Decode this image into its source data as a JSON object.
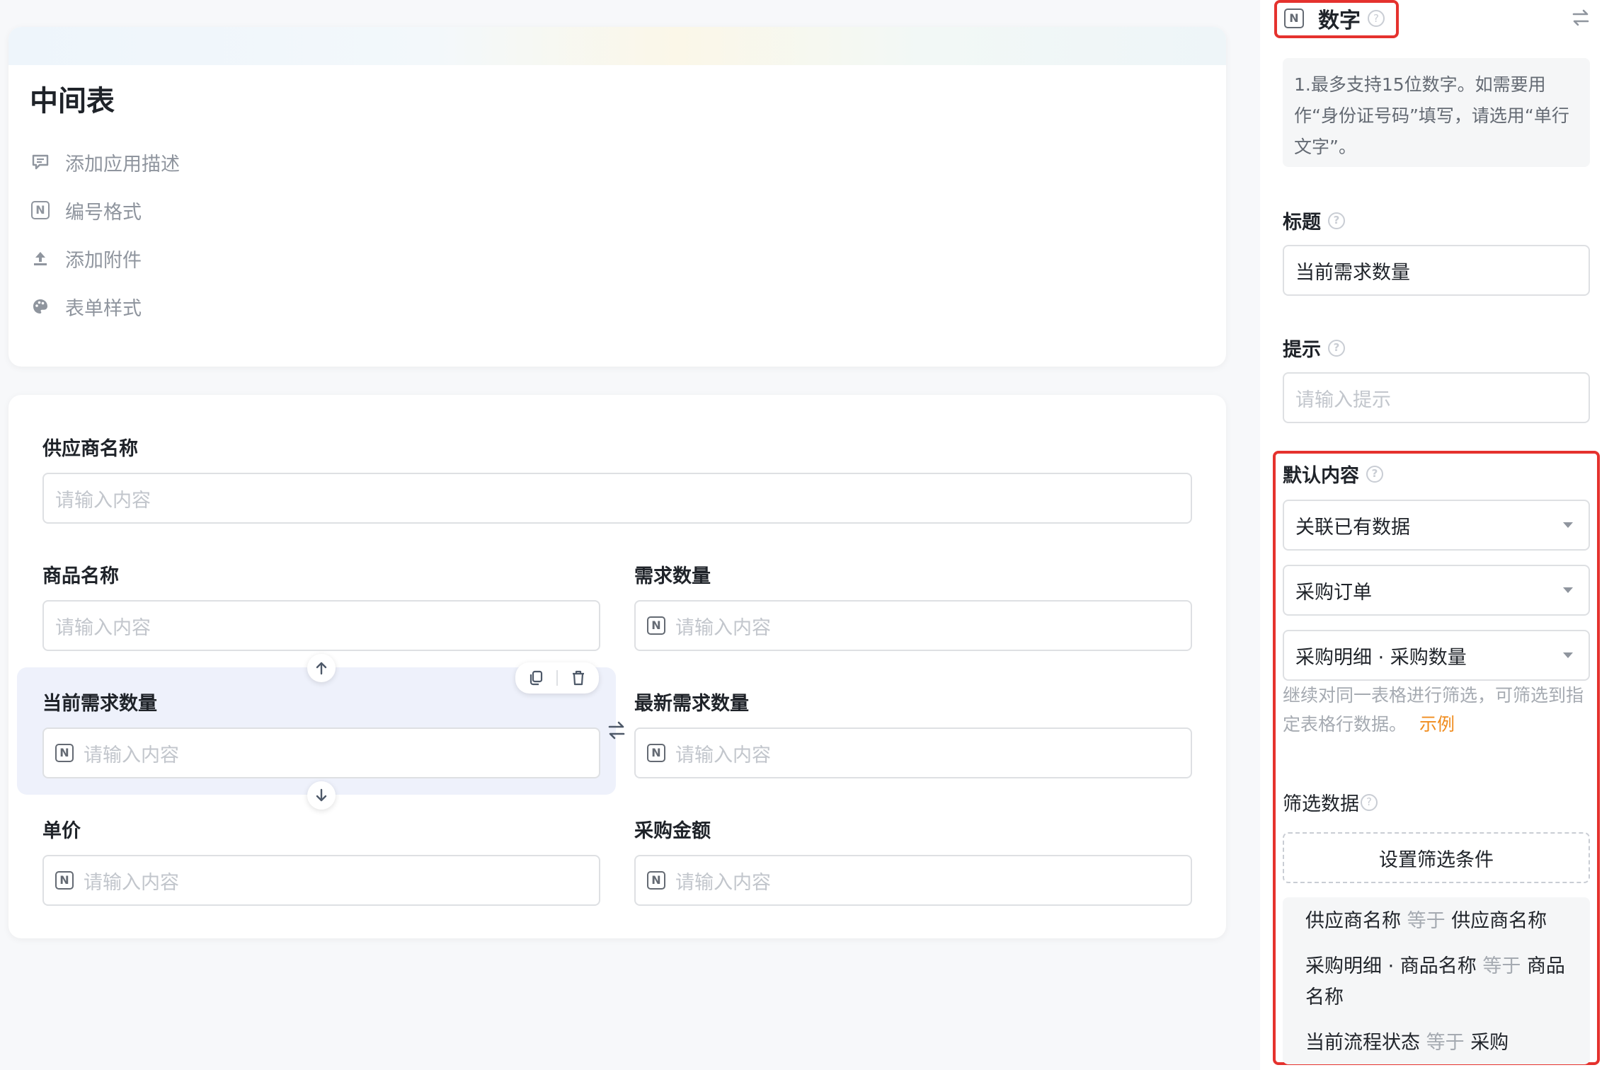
{
  "app": {
    "title": "中间表",
    "links": [
      {
        "label": "添加应用描述",
        "icon": "comment-icon"
      },
      {
        "label": "编号格式",
        "icon": "n-format-icon"
      },
      {
        "label": "添加附件",
        "icon": "upload-icon"
      },
      {
        "label": "表单样式",
        "icon": "palette-icon"
      }
    ]
  },
  "form": {
    "placeholder": "请输入内容",
    "field_type_badge": "N",
    "fields": {
      "supplier": "供应商名称",
      "product": "商品名称",
      "demand_qty": "需求数量",
      "current_demand_qty": "当前需求数量",
      "latest_demand_qty": "最新需求数量",
      "unit_price": "单价",
      "purchase_amount": "采购金额"
    }
  },
  "panel": {
    "type_title": "数字",
    "help_glyph": "?",
    "tip": "1.最多支持15位数字。如需要用作“身份证号码”填写，请选用“单行文字”。",
    "title_label": "标题",
    "title_value": "当前需求数量",
    "hint_label": "提示",
    "hint_placeholder": "请输入提示",
    "default_label": "默认内容",
    "default_mode": "关联已有数据",
    "source_form": "采购订单",
    "source_field": "采购明细 · 采购数量",
    "filter_hint": "继续对同一表格进行筛选，可筛选到指定表格行数据。",
    "example_link": "示例",
    "filter_label": "筛选数据",
    "set_filter_button": "设置筛选条件",
    "conditions": [
      {
        "left": "供应商名称",
        "op": "等于",
        "right": "供应商名称"
      },
      {
        "left": "采购明细 · 商品名称",
        "op": "等于",
        "right": "商品名称"
      },
      {
        "left": "当前流程状态",
        "op": "等于",
        "right": "采购"
      }
    ]
  },
  "colors": {
    "highlight_border": "#e5322e",
    "link": "#f08c1e",
    "selected_bg": "#eef1fb"
  }
}
